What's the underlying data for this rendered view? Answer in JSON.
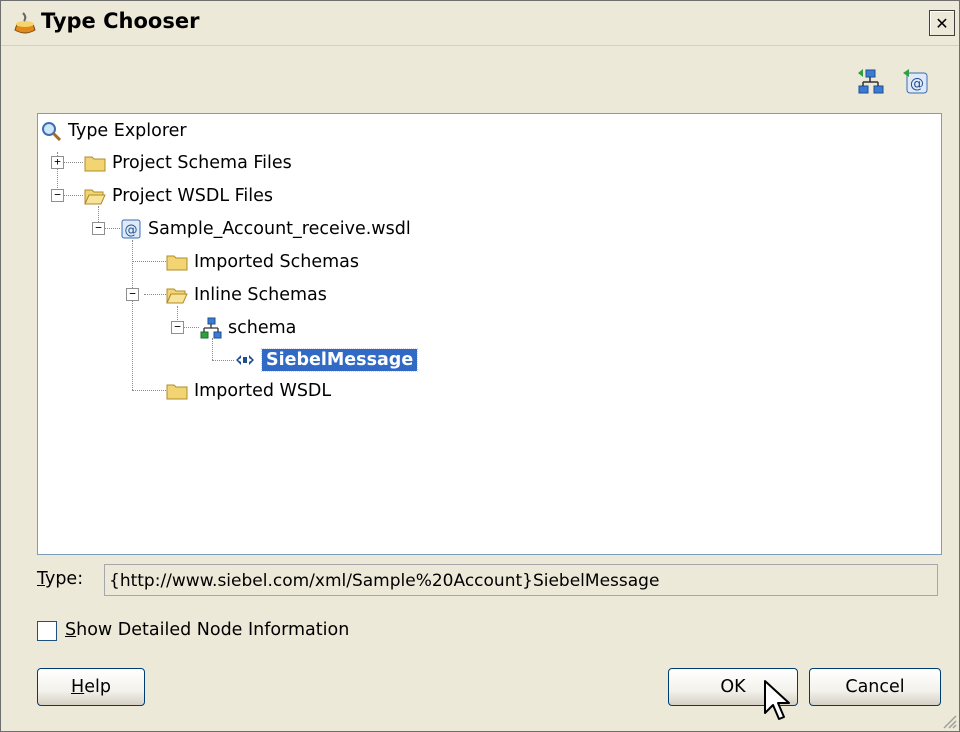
{
  "window": {
    "title": "Type Chooser",
    "close_glyph": "✕"
  },
  "toolbar": {
    "icons": [
      "import-schema-icon",
      "import-wsdl-icon"
    ]
  },
  "tree": {
    "root": "Type Explorer",
    "project_schema_files": "Project Schema Files",
    "project_wsdl_files": "Project WSDL Files",
    "wsdl_file": "Sample_Account_receive.wsdl",
    "imported_schemas": "Imported Schemas",
    "inline_schemas": "Inline Schemas",
    "schema": "schema",
    "selected_element": "SiebelMessage",
    "imported_wsdl": "Imported WSDL"
  },
  "type": {
    "label_prefix": "T",
    "label_rest": "ype:",
    "value": "{http://www.siebel.com/xml/Sample%20Account}SiebelMessage"
  },
  "options": {
    "show_detailed_prefix": "S",
    "show_detailed_rest": "how Detailed Node Information",
    "show_detailed_checked": false
  },
  "buttons": {
    "help_prefix": "H",
    "help_rest": "elp",
    "ok": "OK",
    "cancel": "Cancel"
  },
  "colors": {
    "selection": "#316ac5",
    "dialog_bg": "#ece9d8",
    "folder": "#f2d572"
  }
}
